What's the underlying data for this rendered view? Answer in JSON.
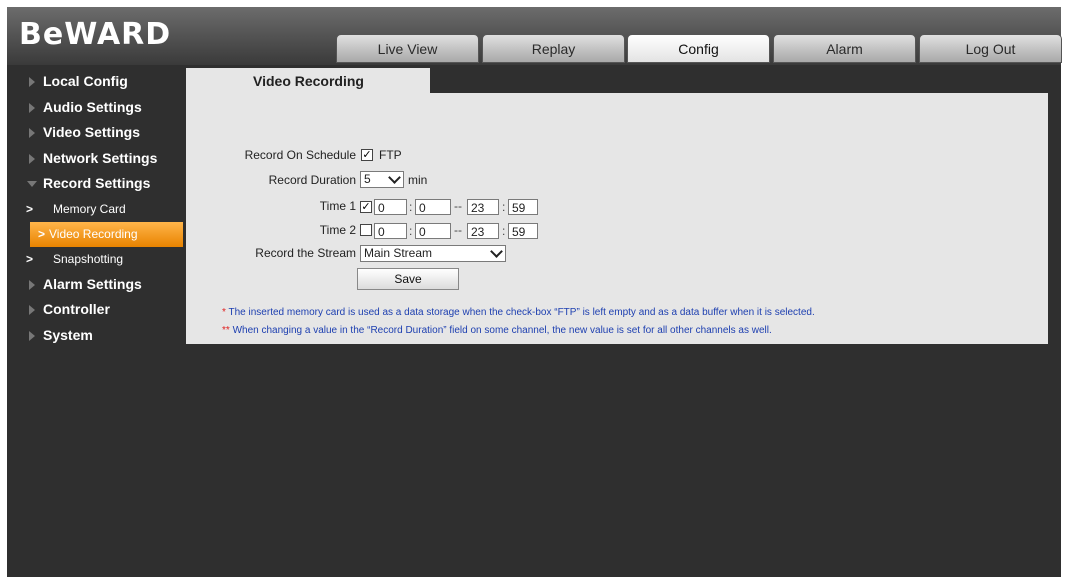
{
  "brand": {
    "logo": "BeWARD"
  },
  "nav": {
    "tabs": [
      {
        "label": "Live View"
      },
      {
        "label": "Replay"
      },
      {
        "label": "Config"
      },
      {
        "label": "Alarm"
      },
      {
        "label": "Log Out"
      }
    ],
    "active": "Config"
  },
  "sidebar": {
    "items": [
      {
        "label": "Local Config"
      },
      {
        "label": "Audio Settings"
      },
      {
        "label": "Video Settings"
      },
      {
        "label": "Network Settings"
      },
      {
        "label": "Record Settings"
      },
      {
        "label": "Alarm Settings"
      },
      {
        "label": "Controller"
      },
      {
        "label": "System"
      }
    ],
    "sub_items": [
      {
        "label": "Memory Card"
      },
      {
        "label": "Video Recording"
      },
      {
        "label": "Snapshotting"
      }
    ],
    "chevron": ">"
  },
  "page": {
    "title": "Video Recording",
    "record_on_schedule": {
      "label": "Record On Schedule",
      "checkbox_label": "FTP",
      "checked": true
    },
    "record_duration": {
      "label": "Record Duration",
      "value": "5",
      "unit": "min"
    },
    "time1": {
      "label": "Time 1",
      "checked": true,
      "start_h": "0",
      "start_m": "0",
      "end_h": "23",
      "end_m": "59"
    },
    "time2": {
      "label": "Time 2",
      "checked": false,
      "start_h": "0",
      "start_m": "0",
      "end_h": "23",
      "end_m": "59"
    },
    "record_stream": {
      "label": "Record the Stream",
      "value": "Main Stream"
    },
    "save_label": "Save",
    "note1_star": "*",
    "note1": "The inserted memory card is used as a data storage when the check-box “FTP” is left empty and as a data buffer when it is selected.",
    "note2_star": "**",
    "note2": "When changing a value in the “Record Duration” field on some channel, the new value is set for all other channels as well.",
    "checkmark": "✓"
  }
}
